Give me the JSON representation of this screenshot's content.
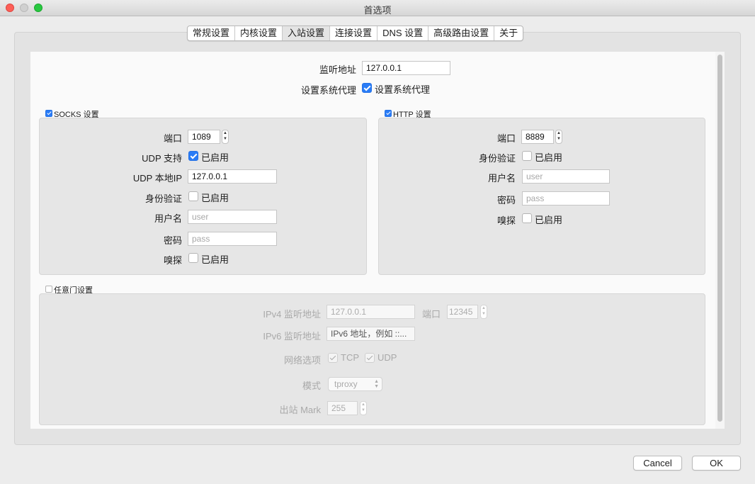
{
  "window": {
    "title": "首选项"
  },
  "tabs": [
    {
      "label": "常规设置"
    },
    {
      "label": "内核设置"
    },
    {
      "label": "入站设置",
      "active": true
    },
    {
      "label": "连接设置"
    },
    {
      "label": "DNS 设置"
    },
    {
      "label": "高级路由设置"
    },
    {
      "label": "关于"
    }
  ],
  "listen": {
    "label": "监听地址",
    "value": "127.0.0.1",
    "sysproxy_label": "设置系统代理",
    "sysproxy_checkbox_label": "设置系统代理",
    "sysproxy_checked": true
  },
  "socks": {
    "title": "SOCKS 设置",
    "enabled": true,
    "port_label": "端口",
    "port_value": "1089",
    "udp_label": "UDP 支持",
    "udp_checkbox_label": "已启用",
    "udp_checked": true,
    "udp_ip_label": "UDP 本地IP",
    "udp_ip_value": "127.0.0.1",
    "auth_label": "身份验证",
    "auth_checkbox_label": "已启用",
    "auth_checked": false,
    "user_label": "用户名",
    "user_placeholder": "user",
    "pass_label": "密码",
    "pass_placeholder": "pass",
    "sniff_label": "嗅探",
    "sniff_checkbox_label": "已启用",
    "sniff_checked": false
  },
  "http": {
    "title": "HTTP 设置",
    "enabled": true,
    "port_label": "端口",
    "port_value": "8889",
    "auth_label": "身份验证",
    "auth_checkbox_label": "已启用",
    "auth_checked": false,
    "user_label": "用户名",
    "user_placeholder": "user",
    "pass_label": "密码",
    "pass_placeholder": "pass",
    "sniff_label": "嗅探",
    "sniff_checkbox_label": "已启用",
    "sniff_checked": false
  },
  "dokodemo": {
    "title": "任意门设置",
    "enabled": false,
    "ipv4_label": "IPv4 监听地址",
    "ipv4_value": "127.0.0.1",
    "port_label": "端口",
    "port_value": "12345",
    "ipv6_label": "IPv6 监听地址",
    "ipv6_placeholder": "IPv6 地址，例如 ::...",
    "network_label": "网络选项",
    "tcp_label": "TCP",
    "tcp_checked": true,
    "udp_label": "UDP",
    "udp_checked": true,
    "mode_label": "模式",
    "mode_value": "tproxy",
    "mark_label": "出站 Mark",
    "mark_value": "255"
  },
  "footer": {
    "cancel_label": "Cancel",
    "ok_label": "OK"
  }
}
